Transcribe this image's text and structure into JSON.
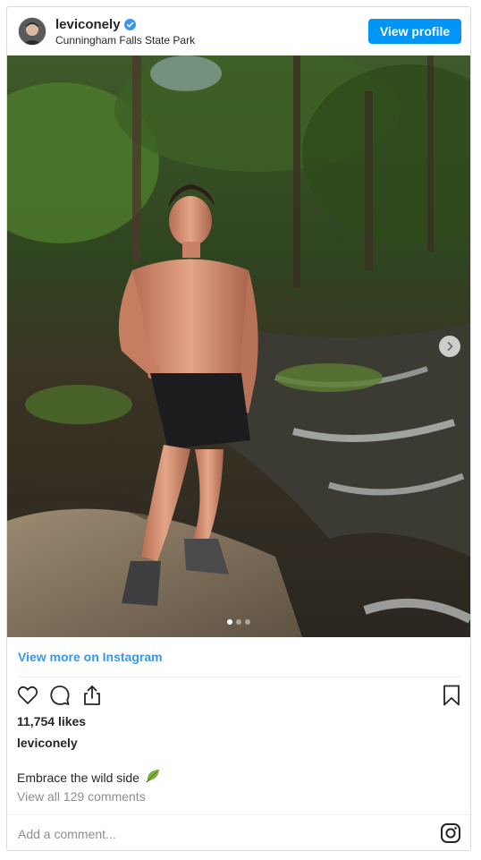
{
  "header": {
    "username": "leviconely",
    "location": "Cunningham Falls State Park",
    "view_profile_label": "View profile",
    "verified_icon": "verified-badge-icon"
  },
  "colors": {
    "accent": "#0095f6",
    "link": "#3897f0",
    "muted": "#8e8e8e",
    "text": "#262626"
  },
  "media": {
    "alt": "Shirtless man standing on rocks by a forest stream",
    "carousel_slides": 3,
    "active_slide": 1,
    "next_icon": "chevron-right-icon"
  },
  "view_more_label": "View more on Instagram",
  "actions": {
    "like_icon": "heart-icon",
    "comment_icon": "comment-icon",
    "share_icon": "share-icon",
    "save_icon": "bookmark-icon"
  },
  "likes_text": "11,754 likes",
  "owner_line": "leviconely",
  "caption_text": "Embrace the wild side",
  "caption_emoji_icon": "leaf-icon",
  "comments_link": "View all 129 comments",
  "comment_input": {
    "placeholder": "Add a comment..."
  },
  "footer_icon": "instagram-icon"
}
